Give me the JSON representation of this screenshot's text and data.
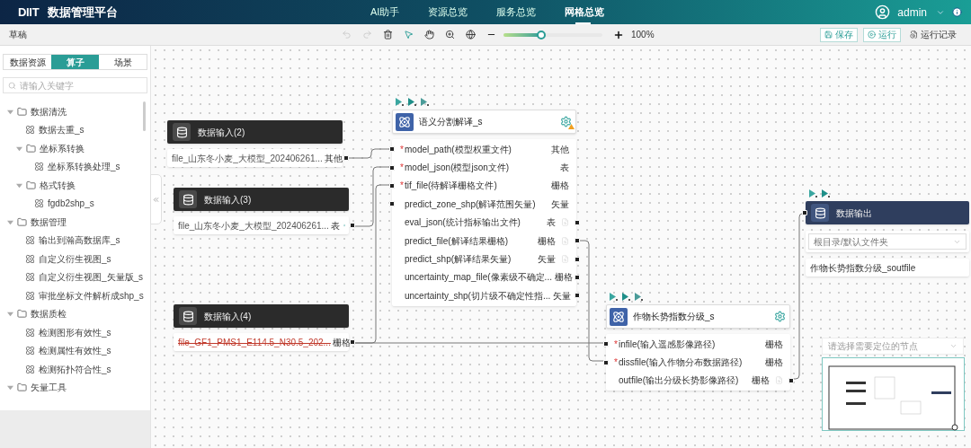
{
  "header": {
    "logo": "DIIT",
    "title": "数据管理平台",
    "nav": [
      {
        "label": "AI助手",
        "selected": false
      },
      {
        "label": "资源总览",
        "selected": false
      },
      {
        "label": "服务总览",
        "selected": false
      },
      {
        "label": "网格总览",
        "selected": true
      }
    ],
    "user": "admin"
  },
  "toolbar": {
    "title": "草稿",
    "zoom": {
      "level": 0.38,
      "reading": "100%"
    },
    "buttons": [
      {
        "label": "保存",
        "kind": "save"
      },
      {
        "label": "运行",
        "kind": "run"
      },
      {
        "label": "运行记录",
        "kind": "log"
      }
    ]
  },
  "sidebar": {
    "tabs": [
      {
        "label": "数据资源",
        "selected": false
      },
      {
        "label": "算子",
        "selected": true
      },
      {
        "label": "场景",
        "selected": false
      }
    ],
    "search": {
      "placeholder": "请输入关键字"
    },
    "tree": [
      {
        "label": "数据清洗",
        "kind": "folder",
        "expanded": true,
        "children": [
          {
            "label": "数据去重_s",
            "kind": "operator"
          },
          {
            "label": "坐标系转换",
            "kind": "folder",
            "expanded": true,
            "children": [
              {
                "label": "坐标系转换处理_s",
                "kind": "operator"
              }
            ]
          },
          {
            "label": "格式转换",
            "kind": "folder",
            "expanded": true,
            "children": [
              {
                "label": "fgdb2shp_s",
                "kind": "operator"
              }
            ]
          }
        ]
      },
      {
        "label": "数据管理",
        "kind": "folder",
        "expanded": true,
        "children": [
          {
            "label": "输出到瀚高数据库_s",
            "kind": "operator"
          },
          {
            "label": "自定义衍生视图_s",
            "kind": "operator"
          },
          {
            "label": "自定义衍生视图_矢量版_s",
            "kind": "operator"
          },
          {
            "label": "审批坐标文件解析成shp_s",
            "kind": "operator"
          }
        ]
      },
      {
        "label": "数据质检",
        "kind": "folder",
        "expanded": true,
        "children": [
          {
            "label": "检测图形有效性_s",
            "kind": "operator"
          },
          {
            "label": "检测属性有效性_s",
            "kind": "operator"
          },
          {
            "label": "检测拓扑符合性_s",
            "kind": "operator"
          }
        ]
      },
      {
        "label": "矢量工具",
        "kind": "folder",
        "expanded": true
      }
    ]
  },
  "canvas": {
    "nodes": [
      {
        "kind": "input",
        "title": "数据输入(2)",
        "file": {
          "text": "file_山东冬小麦_大模型_202406261...",
          "type": "其他",
          "struck": false
        }
      },
      {
        "kind": "input",
        "title": "数据输入(3)",
        "file": {
          "text": "file_山东冬小麦_大模型_202406261...",
          "type": "表",
          "struck": false
        }
      },
      {
        "kind": "input",
        "title": "数据输入(4)",
        "file": {
          "text": "file_GF1_PMS1_E114.5_N30.5_202...",
          "type": "栅格",
          "struck": true
        }
      },
      {
        "kind": "operator",
        "title": "语义分割解译_s",
        "warning": true,
        "ports": [
          {
            "kind": "input",
            "marker": "*",
            "label": "model_path(模型权重文件)",
            "type": "其他"
          },
          {
            "kind": "input",
            "marker": "*",
            "label": "model_json(模型json文件)",
            "type": "表"
          },
          {
            "kind": "input",
            "marker": "*",
            "label": "tif_file(待解译栅格文件)",
            "type": "栅格"
          },
          {
            "kind": "input",
            "label": "predict_zone_shp(解译范围矢量)",
            "type": "矢量"
          },
          {
            "kind": "output",
            "label": "eval_json(统计指标输出文件)",
            "type": "表"
          },
          {
            "kind": "output",
            "label": "predict_file(解译结果栅格)",
            "type": "栅格"
          },
          {
            "kind": "output",
            "label": "predict_shp(解译结果矢量)",
            "type": "矢量"
          },
          {
            "kind": "output",
            "label": "uncertainty_map_file(像素级不确定...",
            "type": "栅格"
          },
          {
            "kind": "output",
            "label": "uncertainty_shp(切片级不确定性指...",
            "type": "矢量"
          }
        ]
      },
      {
        "kind": "operator",
        "title": "作物长势指数分级_s",
        "warning": false,
        "ports": [
          {
            "kind": "input",
            "marker": "*",
            "label": "infile(输入遥感影像路径)",
            "type": "栅格"
          },
          {
            "kind": "input",
            "marker": "*",
            "label": "dissfile(输入作物分布数据路径)",
            "type": "栅格"
          },
          {
            "kind": "output",
            "label": "outfile(输出分级长势影像路径)",
            "type": "栅格"
          }
        ]
      },
      {
        "kind": "output",
        "title": "数据输出",
        "folder": "根目录/默认文件夹",
        "file": "作物长势指数分级_soutfile"
      }
    ]
  },
  "locator": {
    "placeholder": "请选择需要定位的节点"
  }
}
